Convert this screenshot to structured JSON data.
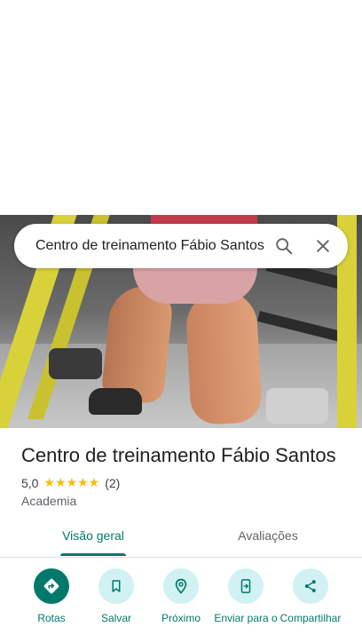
{
  "search": {
    "query": "Centro de treinamento Fábio Santos",
    "search_icon": "search-icon",
    "close_icon": "close-icon"
  },
  "place": {
    "name": "Centro de treinamento Fábio Santos",
    "rating": "5,0",
    "stars": "★★★★★",
    "review_count": "(2)",
    "category": "Academia"
  },
  "tabs": [
    {
      "label": "Visão geral",
      "selected": true
    },
    {
      "label": "Avaliações",
      "selected": false
    }
  ],
  "actions": [
    {
      "label": "Rotas",
      "icon": "directions-icon"
    },
    {
      "label": "Salvar",
      "icon": "bookmark-icon"
    },
    {
      "label": "Próximo",
      "icon": "nearby-icon"
    },
    {
      "label": "Enviar para o",
      "icon": "send-to-phone-icon"
    },
    {
      "label": "Compartilhar",
      "icon": "share-icon"
    }
  ],
  "colors": {
    "accent": "#00796b",
    "action_bg": "#d2f1f3",
    "star": "#fbbc04"
  }
}
